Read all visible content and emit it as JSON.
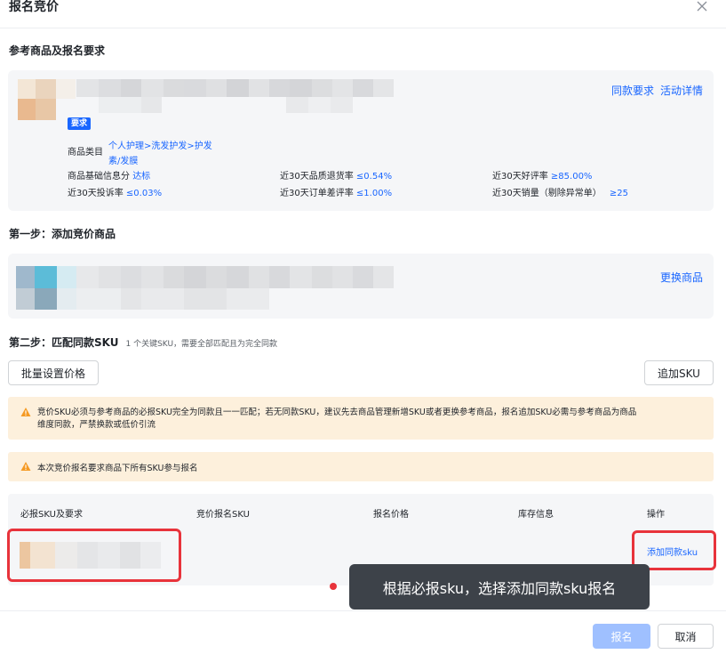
{
  "dialog": {
    "title": "报名竞价"
  },
  "reference": {
    "section_title": "参考商品及报名要求",
    "links": {
      "same_req": "同款要求",
      "activity_detail": "活动详情"
    },
    "badge": "要求",
    "category_label": "商品类目",
    "category_value_line1": "个人护理>洗发护发>护发",
    "category_value_line2": "素/发膜",
    "metrics": [
      {
        "label": "商品基础信息分",
        "value": "达标"
      },
      {
        "label": "近30天品质退货率",
        "value": "≤0.54%"
      },
      {
        "label": "近30天好评率",
        "value": "≥85.00%"
      },
      {
        "label": "近30天投诉率",
        "value": "≤0.03%"
      },
      {
        "label": "近30天订单差评率",
        "value": "≤1.00%"
      },
      {
        "label": "近30天销量（剔除异常单）",
        "value": "≥25"
      }
    ]
  },
  "step1": {
    "title": "第一步：添加竞价商品",
    "replace_link": "更换商品"
  },
  "step2": {
    "title": "第二步：匹配同款SKU",
    "hint": "1 个关键SKU，需要全部匹配且为完全同款",
    "batch_price_button": "批量设置价格",
    "add_sku_button": "追加SKU",
    "warning1_line1": "竞价SKU必须与参考商品的必报SKU完全为同款且一一匹配；若无同款SKU，建议先去商品管理新增SKU或者更换参考商品，报名追加SKU必需与参考商品为商品",
    "warning1_line2": "维度同款，严禁换款或低价引流",
    "warning2": "本次竞价报名要求商品下所有SKU参与报名",
    "table_headers": [
      "必报SKU及要求",
      "竞价报名SKU",
      "报名价格",
      "库存信息",
      "操作"
    ],
    "row_action": "添加同款sku"
  },
  "tooltip": {
    "text": "根据必报sku，选择添加同款sku报名"
  },
  "footer": {
    "submit": "报名",
    "cancel": "取消"
  },
  "colors": {
    "accent": "#1966ff",
    "warning_bg": "#fdf0dc",
    "warning_icon": "#f59a23",
    "highlight": "#e8333b"
  }
}
